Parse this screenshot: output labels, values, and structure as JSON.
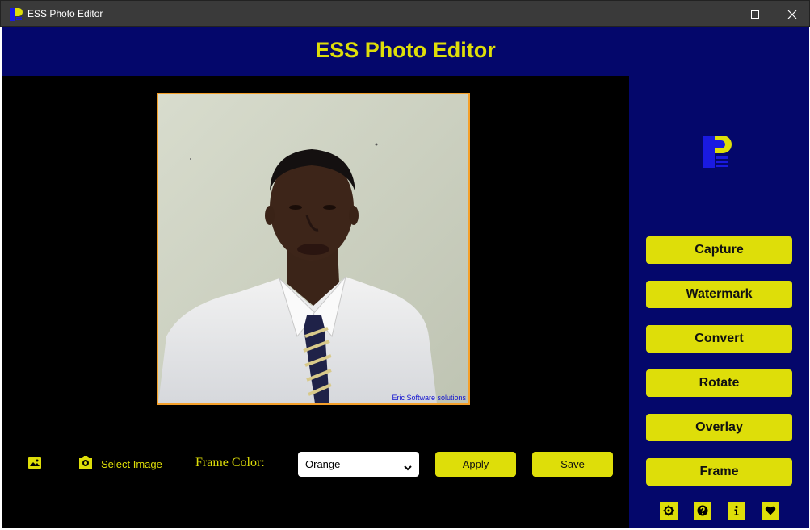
{
  "window": {
    "title": "ESS Photo Editor",
    "icons": {
      "app": "app-logo-icon",
      "minimize": "minimize-icon",
      "maximize": "maximize-icon",
      "close": "close-icon"
    }
  },
  "header": {
    "title": "ESS Photo Editor"
  },
  "photo": {
    "watermark": "Eric Software solutions",
    "frame_color": "#f5a02a"
  },
  "toolbar": {
    "gallery_icon": "image-icon",
    "select_image_icon": "camera-icon",
    "select_image_label": "Select Image",
    "frame_color_label": "Frame Color:",
    "frame_color_value": "Orange",
    "apply_label": "Apply",
    "save_label": "Save"
  },
  "sidebar": {
    "buttons": [
      {
        "label": "Capture"
      },
      {
        "label": "Watermark"
      },
      {
        "label": "Convert"
      },
      {
        "label": "Rotate"
      },
      {
        "label": "Overlay"
      },
      {
        "label": "Frame"
      }
    ],
    "icon_buttons": [
      "settings-icon",
      "help-icon",
      "info-icon",
      "heart-icon"
    ]
  },
  "colors": {
    "accent": "#dede09",
    "header_bg": "#04076b",
    "canvas_bg": "#000000",
    "titlebar_bg": "#3a3a3a"
  }
}
